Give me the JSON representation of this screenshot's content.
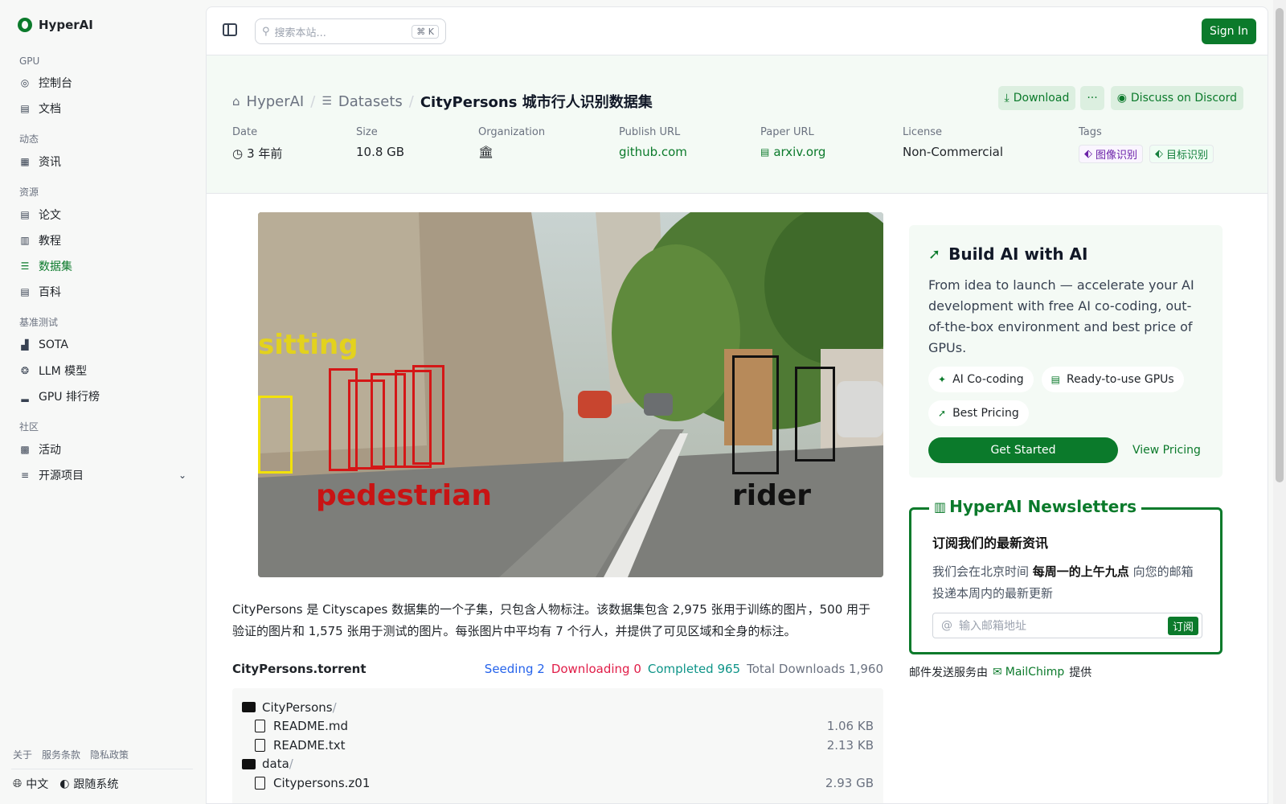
{
  "app": {
    "name": "HyperAI"
  },
  "sidebar": {
    "sections": [
      {
        "title": "GPU",
        "items": [
          {
            "label": "控制台",
            "icon": "dashboard-icon"
          },
          {
            "label": "文档",
            "icon": "doc-icon"
          }
        ]
      },
      {
        "title": "动态",
        "items": [
          {
            "label": "资讯",
            "icon": "news-icon"
          }
        ]
      },
      {
        "title": "资源",
        "items": [
          {
            "label": "论文",
            "icon": "paper-icon"
          },
          {
            "label": "教程",
            "icon": "book-icon"
          },
          {
            "label": "数据集",
            "icon": "database-icon",
            "active": true
          },
          {
            "label": "百科",
            "icon": "wiki-icon"
          }
        ]
      },
      {
        "title": "基准测试",
        "items": [
          {
            "label": "SOTA",
            "icon": "chart-icon"
          },
          {
            "label": "LLM 模型",
            "icon": "model-icon"
          },
          {
            "label": "GPU 排行榜",
            "icon": "leaderboard-icon"
          }
        ]
      },
      {
        "title": "社区",
        "items": [
          {
            "label": "活动",
            "icon": "event-icon"
          },
          {
            "label": "开源项目",
            "icon": "list-icon",
            "expandable": true
          }
        ]
      }
    ],
    "footer_links": [
      "关于",
      "服务条款",
      "隐私政策"
    ],
    "language": "中文",
    "theme": "跟随系统"
  },
  "topbar": {
    "search_placeholder": "搜索本站...",
    "search_shortcut": "K",
    "signin_label": "Sign In"
  },
  "breadcrumb": {
    "home": "HyperAI",
    "section": "Datasets",
    "current": "CityPersons 城市行人识别数据集"
  },
  "actions": {
    "download": "Download",
    "more": "···",
    "discord": "Discuss on Discord"
  },
  "meta": {
    "date": {
      "label": "Date",
      "value": "3 年前"
    },
    "size": {
      "label": "Size",
      "value": "10.8 GB"
    },
    "organization": {
      "label": "Organization"
    },
    "publish_url": {
      "label": "Publish URL",
      "value": "github.com"
    },
    "paper_url": {
      "label": "Paper URL",
      "value": "arxiv.org"
    },
    "license": {
      "label": "License",
      "value": "Non-Commercial"
    },
    "tags": {
      "label": "Tags",
      "items": [
        "图像识别",
        "目标识别"
      ]
    }
  },
  "image_labels": {
    "sitting": "sitting",
    "pedestrian": "pedestrian",
    "rider": "rider"
  },
  "description": "CityPersons 是 Cityscapes 数据集的一个子集，只包含人物标注。该数据集包含 2,975 张用于训练的图片，500 用于验证的图片和 1,575 张用于测试的图片。每张图片中平均有 7 个行人，并提供了可见区域和全身的标注。",
  "torrent": {
    "name": "CityPersons.torrent",
    "seeding": "Seeding 2",
    "downloading": "Downloading 0",
    "completed": "Completed 965",
    "total": "Total Downloads 1,960",
    "files": [
      {
        "name": "CityPersons",
        "type": "folder",
        "size": ""
      },
      {
        "name": "README.md",
        "type": "file",
        "size": "1.06 KB"
      },
      {
        "name": "README.txt",
        "type": "file",
        "size": "2.13 KB"
      },
      {
        "name": "data",
        "type": "folder",
        "size": ""
      },
      {
        "name": "Citypersons.z01",
        "type": "file",
        "size": "2.93 GB"
      }
    ]
  },
  "promo": {
    "title": "Build AI with AI",
    "text": "From idea to launch — accelerate your AI development with free AI co-coding, out-of-the-box environment and best price of GPUs.",
    "chips": [
      "AI Co-coding",
      "Ready-to-use GPUs",
      "Best Pricing"
    ],
    "cta": "Get Started",
    "secondary": "View Pricing"
  },
  "newsletter": {
    "legend": "HyperAI Newsletters",
    "title": "订阅我们的最新资讯",
    "text_pre": "我们会在北京时间 ",
    "text_bold": "每周一的上午九点",
    "text_post": " 向您的邮箱投递本周内的最新更新",
    "placeholder": "输入邮箱地址",
    "subscribe": "订阅",
    "provider_pre": "邮件发送服务由",
    "provider": "MailChimp",
    "provider_post": "提供"
  },
  "colors": {
    "brand": "#0b7a2b",
    "header_bg": "#f4faf5"
  }
}
